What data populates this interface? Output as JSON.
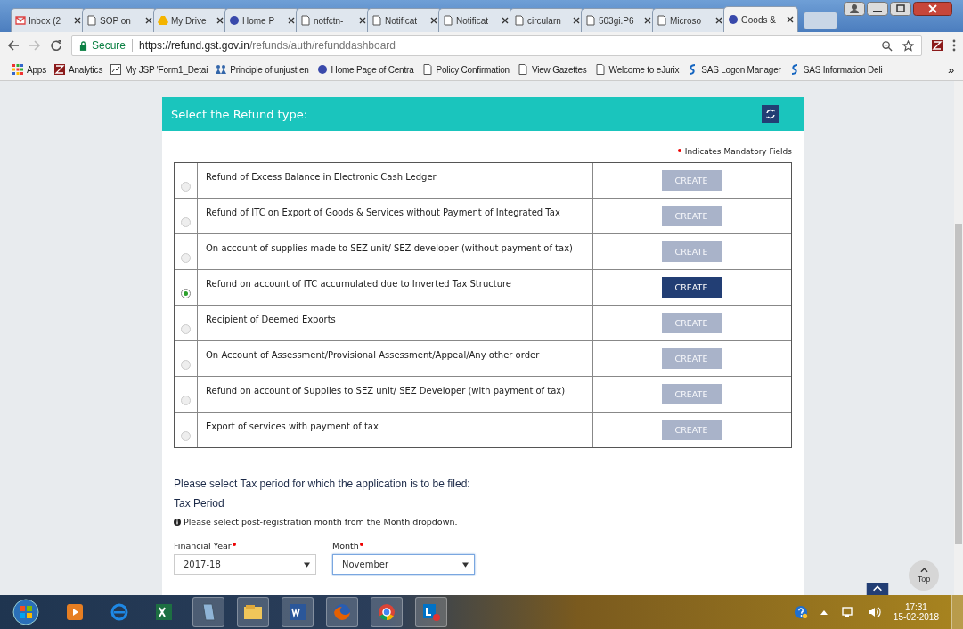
{
  "browser": {
    "tabs": [
      {
        "label": "Inbox (2",
        "kind": "mail",
        "selected": false
      },
      {
        "label": "SOP on",
        "kind": "doc",
        "selected": false
      },
      {
        "label": "My Drive",
        "kind": "drive",
        "selected": false
      },
      {
        "label": "Home P",
        "kind": "emblem",
        "selected": false
      },
      {
        "label": "notfctn-",
        "kind": "doc",
        "selected": false
      },
      {
        "label": "Notificat",
        "kind": "doc",
        "selected": false
      },
      {
        "label": "Notificat",
        "kind": "doc",
        "selected": false
      },
      {
        "label": "circularn",
        "kind": "doc",
        "selected": false
      },
      {
        "label": "503gi.P6",
        "kind": "doc",
        "selected": false
      },
      {
        "label": "Microso",
        "kind": "doc",
        "selected": false
      },
      {
        "label": "Goods &",
        "kind": "emblem",
        "selected": true
      }
    ],
    "secure_label": "Secure",
    "url_host": "https://refund.gst.gov.in",
    "url_path": "/refunds/auth/refunddashboard",
    "bookmarks": [
      {
        "label": "Apps",
        "kind": "apps"
      },
      {
        "label": "Analytics",
        "kind": "red"
      },
      {
        "label": "My JSP 'Form1_Detai",
        "kind": "chart"
      },
      {
        "label": "Principle of unjust en",
        "kind": "people"
      },
      {
        "label": "Home Page of Centra",
        "kind": "emblem"
      },
      {
        "label": "Policy Confirmation",
        "kind": "doc"
      },
      {
        "label": "View Gazettes",
        "kind": "doc"
      },
      {
        "label": "Welcome to eJurix",
        "kind": "doc"
      },
      {
        "label": "SAS Logon Manager",
        "kind": "sas"
      },
      {
        "label": "SAS Information Deli",
        "kind": "sas"
      }
    ],
    "bookmarks_more": "»"
  },
  "panel": {
    "title": "Select the Refund type:",
    "mandatory_note": "Indicates Mandatory Fields",
    "options": [
      {
        "label": "Refund of Excess Balance in Electronic Cash Ledger",
        "selected": false,
        "button": "CREATE",
        "disabled": true
      },
      {
        "label": "Refund of ITC on Export of Goods & Services without Payment of Integrated Tax",
        "selected": false,
        "button": "CREATE",
        "disabled": true
      },
      {
        "label": "On account of supplies made to SEZ unit/ SEZ developer (without payment of tax)",
        "selected": false,
        "button": "CREATE",
        "disabled": true
      },
      {
        "label": "Refund on account of ITC accumulated due to Inverted Tax Structure",
        "selected": true,
        "button": "CREATE",
        "disabled": false
      },
      {
        "label": "Recipient of Deemed Exports",
        "selected": false,
        "button": "CREATE",
        "disabled": true
      },
      {
        "label": "On Account of Assessment/Provisional Assessment/Appeal/Any other order",
        "selected": false,
        "button": "CREATE",
        "disabled": true
      },
      {
        "label": "Refund on account of Supplies to SEZ unit/ SEZ Developer (with payment of tax)",
        "selected": false,
        "button": "CREATE",
        "disabled": true
      },
      {
        "label": "Export of services with payment of tax",
        "selected": false,
        "button": "CREATE",
        "disabled": true
      }
    ],
    "period_prompt": "Please select Tax period for which the application is to be filed:",
    "period_heading": "Tax Period",
    "period_hint": "Please select post-registration month from the Month dropdown.",
    "fields": [
      {
        "label": "Financial Year",
        "value": "2017-18",
        "focused": false
      },
      {
        "label": "Month",
        "value": "November",
        "focused": true
      }
    ]
  },
  "top_button": "Top",
  "taskbar": {
    "time": "17:31",
    "date": "15-02-2018"
  }
}
